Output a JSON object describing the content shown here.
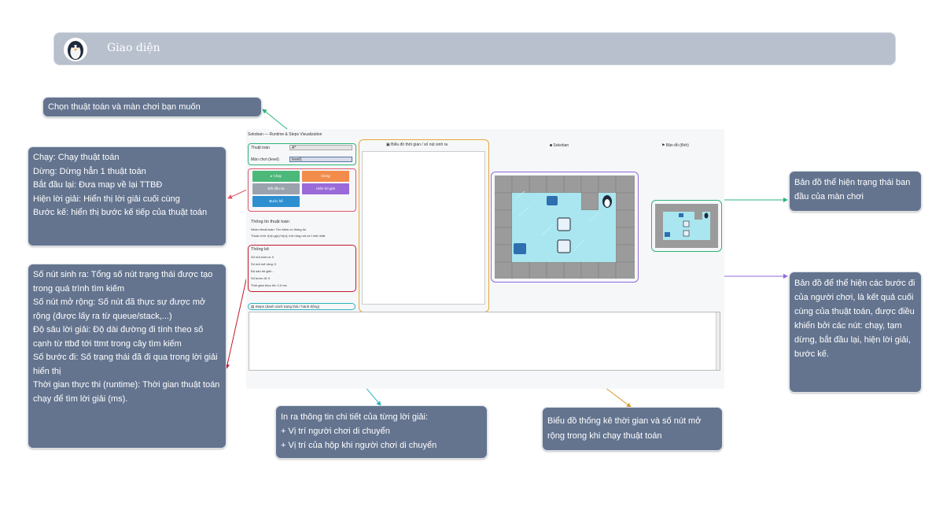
{
  "header": {
    "title": "Giao diện"
  },
  "notes": {
    "algo_select": "Chọn thuật toán và màn chơi bạn muốn",
    "buttons": [
      "Chạy: Chạy thuật toán",
      "Dừng: Dừng hẳn 1 thuật toán",
      "Bắt đầu lại: Đưa map về lại TTBĐ",
      "Hiện lời giải: Hiển thị lời giải cuối cùng",
      "Bước kế: hiển thị bước kế tiếp của thuật toán"
    ],
    "stats": [
      "Số nút sinh ra: Tổng số nút trạng thái được tạo trong quá trình tìm kiếm",
      "Số nút mở rộng: Số nút đã thực sự được mở rộng (được lấy ra từ queue/stack,...)",
      "Độ sâu lời giải: Độ dài đường đi tính theo số cạnh từ ttbđ tới ttmt trong cây tìm kiếm",
      "Số bước đi: Số trạng thái đã đi qua trong lời giải hiển thị",
      "Thời gian thực thi (runtime): Thời gian thuật toán chạy để tìm lời giải (ms)."
    ],
    "steps": [
      "In ra thông tin chi tiết của từng lời giải:",
      "+ Vị trí người chơi di chuyển",
      "+ Vị trí của hộp khi người chơi di chuyển"
    ],
    "chart": "Biểu đồ thống kê thời gian và số nút mở rộng trong khi chạy thuật toán",
    "initial_map": "Bản đồ thể hiện trạng thái ban đầu của màn chơi",
    "game_map": "Bản đồ để thể hiện các bước đi của người chơi, là kết quả cuối cùng của thuật toán, được điều khiển bởi các nút: chạy, tạm dừng, bắt đầu lại, hiện lời giải, bước kế."
  },
  "app": {
    "window_title": "Sokoban — Runtime & Steps Visualization",
    "algo_label": "Thuật toán",
    "algo_value": "A*",
    "level_label": "Màn chơi (level)",
    "level_value": "level1",
    "btn_run": "▸ Chạy",
    "btn_stop": "Dừng",
    "btn_restart": "Bắt đầu lại",
    "btn_solution": "Hiện lời giải",
    "btn_next": "Bước kế",
    "info_title": "Thông tin thuật toán",
    "info_group": "Nhóm thuật toán: Tìm kiếm có thông tin",
    "info_desc": "Thuộc tính: f(n)=g(n)+h(n); mở rộng nút có f nhỏ nhất",
    "stats_title": "Thống kê",
    "stat_generated": "Số nút sinh ra: 0",
    "stat_expanded": "Số nút mở rộng: 0",
    "stat_depth": "Độ sâu lời giải: -",
    "stat_steps": "Số bước đi: 0",
    "stat_runtime": "Thời gian thực thi: 0.0 ms",
    "chart_tab": "Biểu đồ thời gian / số nút sinh ra",
    "sokoban_tab": "Sokoban",
    "map_tab": "Bản đồ (tĩnh)",
    "steps_title": "Steps (danh sách trạng thái / hành động)"
  },
  "colors": {
    "note_bg": "#64748f",
    "header_bg": "#b8c0cd",
    "select_box": "#2db37a",
    "button_box": "#e0576a",
    "chart_box": "#e0a93a",
    "game_box": "#8f6bdc",
    "steps_box": "#2ab3c0"
  }
}
